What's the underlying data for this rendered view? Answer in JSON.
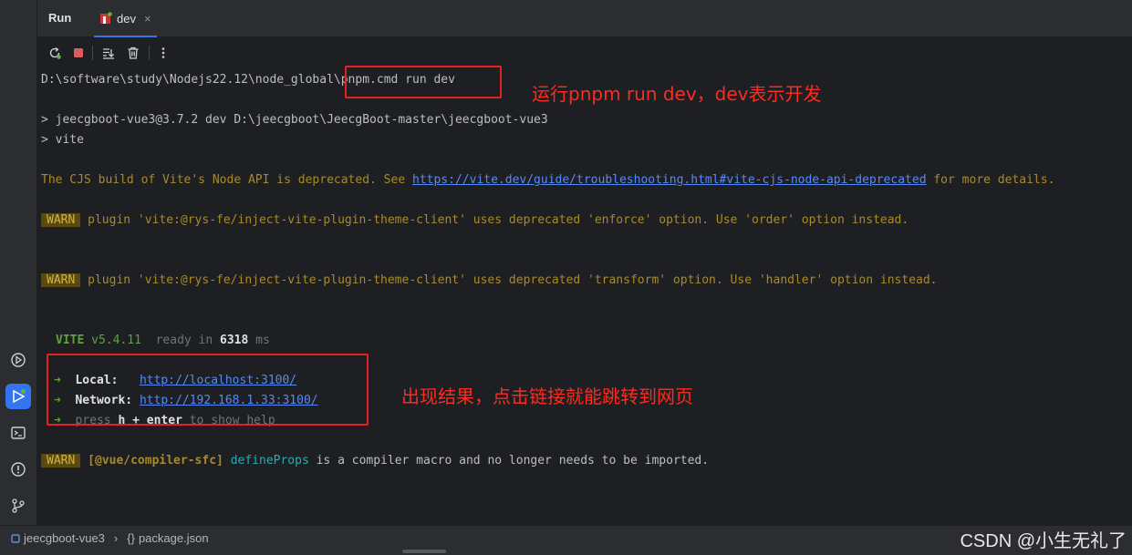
{
  "tabs": {
    "run_label": "Run",
    "dev_label": "dev",
    "close_glyph": "×"
  },
  "toolbar": {
    "icons": [
      "rerun-icon",
      "stop-icon",
      "scroll-to-end-icon",
      "clear-icon",
      "more-icon"
    ]
  },
  "console": {
    "cmd_prefix": "D:\\software\\study\\Nodejs22.12\\node_global\\",
    "cmd": "pnpm.cmd run dev",
    "script_line": "> jeecgboot-vue3@3.7.2 dev D:\\jeecgboot\\JeecgBoot-master\\jeecgboot-vue3",
    "vite_line": "> vite",
    "cjs_pre": "The CJS build of Vite's Node API is deprecated. See ",
    "cjs_link": "https://vite.dev/guide/troubleshooting.html#vite-cjs-node-api-deprecated",
    "cjs_post": " for more details.",
    "warn_label": "WARN",
    "warn1": " plugin 'vite:@rys-fe/inject-vite-plugin-theme-client' uses deprecated 'enforce' option. Use 'order' option instead.",
    "warn2": " plugin 'vite:@rys-fe/inject-vite-plugin-theme-client' uses deprecated 'transform' option. Use 'handler' option instead.",
    "vite_name": "VITE",
    "vite_version": " v5.4.11",
    "ready_text": "  ready in ",
    "ready_ms": "6318",
    "ms_unit": " ms",
    "arrow": "➜",
    "local_label": "Local:",
    "local_url": "http://localhost:3100/",
    "network_label": "Network:",
    "network_url": "http://192.168.1.33:3100/",
    "help_pre": "press ",
    "help_key": "h + enter",
    "help_post": " to show help",
    "sfc_tag": "[@vue/compiler-sfc]",
    "sfc_fn": "defineProps",
    "sfc_post": " is a compiler macro and no longer needs to be imported."
  },
  "annotations": {
    "top": "运行pnpm run dev，dev表示开发",
    "bottom": "出现结果，点击链接就能跳转到网页"
  },
  "statusbar": {
    "project": "jeecgboot-vue3",
    "separator": "›",
    "file_icon_glyph": "{}",
    "file": "package.json",
    "watermark": "CSDN @小生无礼了"
  },
  "colors": {
    "accent": "#3574f0",
    "annotation_red": "#e3231f",
    "warn_badge": "#5a4a10",
    "link": "#548af7"
  }
}
